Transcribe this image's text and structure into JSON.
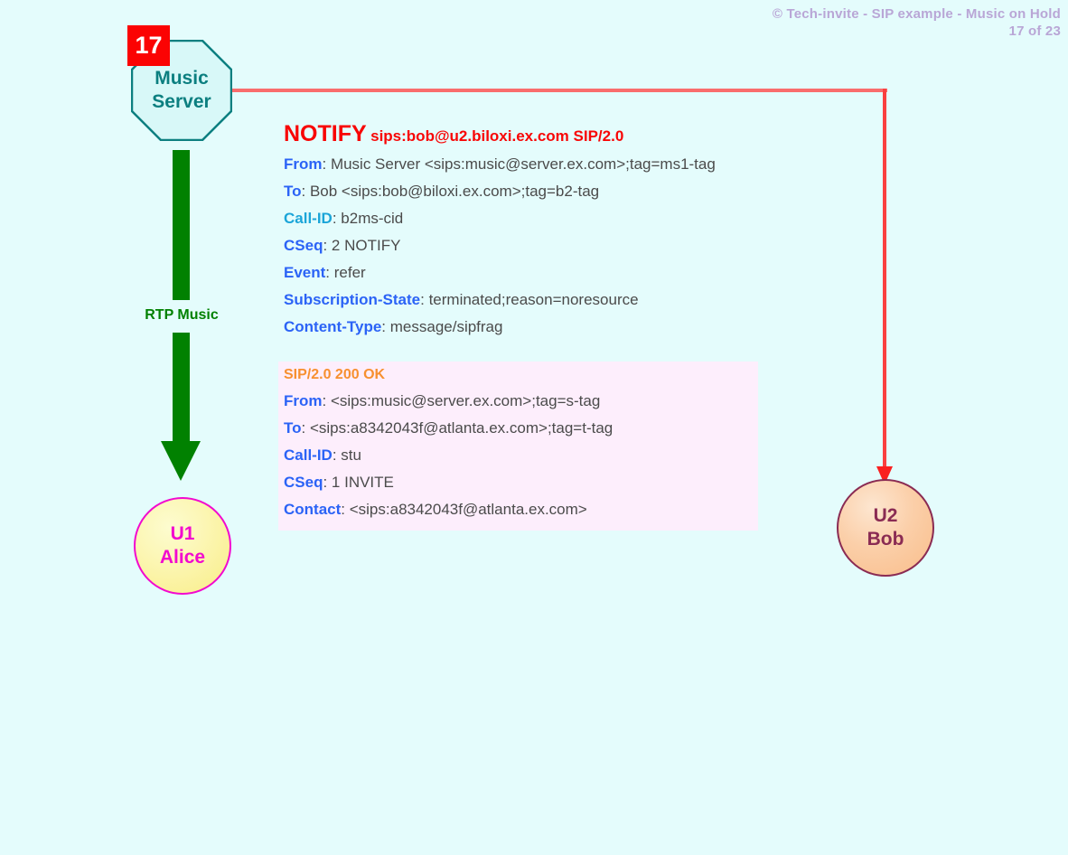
{
  "page": {
    "background_color": "#e4fcfc",
    "header_line1": "© Tech-invite - SIP example - Music on Hold",
    "header_line2": "17 of 23",
    "header_color": "#b9a6d6",
    "step_number": "17",
    "step_badge_color": "#fb0303"
  },
  "nodes": {
    "music_server": {
      "name": "music-server",
      "label_line1": "Music",
      "label_line2": "Server",
      "shape": "octagon",
      "border_color": "#0c7f80",
      "fill_color": "#d8f8f8",
      "text_color": "#0c7f80"
    },
    "alice": {
      "name": "user-alice",
      "label_line1": "U1",
      "label_line2": "Alice",
      "shape": "circle",
      "border_color": "#f209cf",
      "text_color": "#f209cf"
    },
    "bob": {
      "name": "user-bob",
      "label_line1": "U2",
      "label_line2": "Bob",
      "shape": "circle",
      "border_color": "#8a2b53",
      "text_color": "#8a2b53"
    }
  },
  "flows": {
    "rtp": {
      "label": "RTP Music",
      "color": "#018101",
      "direction": "music-server-to-alice"
    },
    "signalling": {
      "color": "#f96d6d",
      "arrow_color": "#fa2020",
      "direction": "music-server-to-bob"
    }
  },
  "messages": [
    {
      "id": "notify",
      "kind": "request",
      "method": "NOTIFY",
      "request_uri": "sips:bob@u2.biloxi.ex.com SIP/2.0",
      "start_line_color": "#f80505",
      "background": "transparent",
      "headers": [
        {
          "name": "From",
          "name_color": "blue",
          "value": ": Music Server <sips:music@server.ex.com>;tag=ms1-tag"
        },
        {
          "name": "To",
          "name_color": "blue",
          "value": ": Bob <sips:bob@biloxi.ex.com>;tag=b2-tag"
        },
        {
          "name": "Call-ID",
          "name_color": "teal",
          "value": ": b2ms-cid"
        },
        {
          "name": "CSeq",
          "name_color": "blue",
          "value": ": 2 NOTIFY"
        },
        {
          "name": "Event",
          "name_color": "blue",
          "value": ": refer"
        },
        {
          "name": "Subscription-State",
          "name_color": "blue",
          "value": ": terminated;reason=noresource"
        },
        {
          "name": "Content-Type",
          "name_color": "blue",
          "value": ": message/sipfrag"
        }
      ]
    },
    {
      "id": "ok200",
      "kind": "response",
      "status_line": "SIP/2.0 200 OK",
      "start_line_color": "#f79030",
      "background": "#fdeefc",
      "headers": [
        {
          "name": "From",
          "name_color": "blue",
          "value": ": <sips:music@server.ex.com>;tag=s-tag"
        },
        {
          "name": "To",
          "name_color": "blue",
          "value": ": <sips:a8342043f@atlanta.ex.com>;tag=t-tag"
        },
        {
          "name": "Call-ID",
          "name_color": "blue",
          "value": ": stu"
        },
        {
          "name": "CSeq",
          "name_color": "blue",
          "value": ": 1 INVITE"
        },
        {
          "name": "Contact",
          "name_color": "blue",
          "value": ": <sips:a8342043f@atlanta.ex.com>"
        }
      ]
    }
  ]
}
